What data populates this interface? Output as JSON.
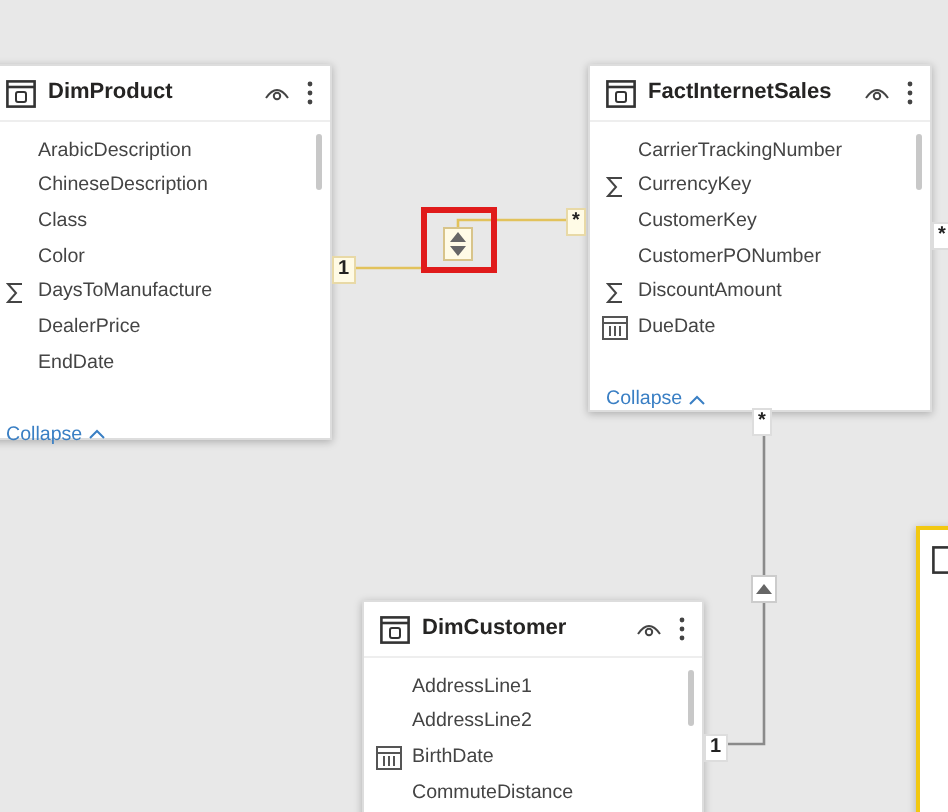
{
  "tables": [
    {
      "name": "DimProduct",
      "fields": [
        {
          "name": "ArabicDescription",
          "kind": "text"
        },
        {
          "name": "ChineseDescription",
          "kind": "text"
        },
        {
          "name": "Class",
          "kind": "text"
        },
        {
          "name": "Color",
          "kind": "text"
        },
        {
          "name": "DaysToManufacture",
          "kind": "sum"
        },
        {
          "name": "DealerPrice",
          "kind": "text"
        },
        {
          "name": "EndDate",
          "kind": "text"
        }
      ],
      "footer": "Collapse",
      "selected": false
    },
    {
      "name": "FactInternetSales",
      "fields": [
        {
          "name": "CarrierTrackingNumber",
          "kind": "text"
        },
        {
          "name": "CurrencyKey",
          "kind": "sum"
        },
        {
          "name": "CustomerKey",
          "kind": "text"
        },
        {
          "name": "CustomerPONumber",
          "kind": "text"
        },
        {
          "name": "DiscountAmount",
          "kind": "sum"
        },
        {
          "name": "DueDate",
          "kind": "date"
        }
      ],
      "footer": "Collapse",
      "selected": false
    },
    {
      "name": "DimCustomer",
      "fields": [
        {
          "name": "AddressLine1",
          "kind": "text"
        },
        {
          "name": "AddressLine2",
          "kind": "text"
        },
        {
          "name": "BirthDate",
          "kind": "date"
        },
        {
          "name": "CommuteDistance",
          "kind": "text"
        }
      ],
      "selected": false
    },
    {
      "selected": true
    }
  ],
  "markers": [
    "1",
    "*",
    "*",
    "*",
    "1"
  ]
}
